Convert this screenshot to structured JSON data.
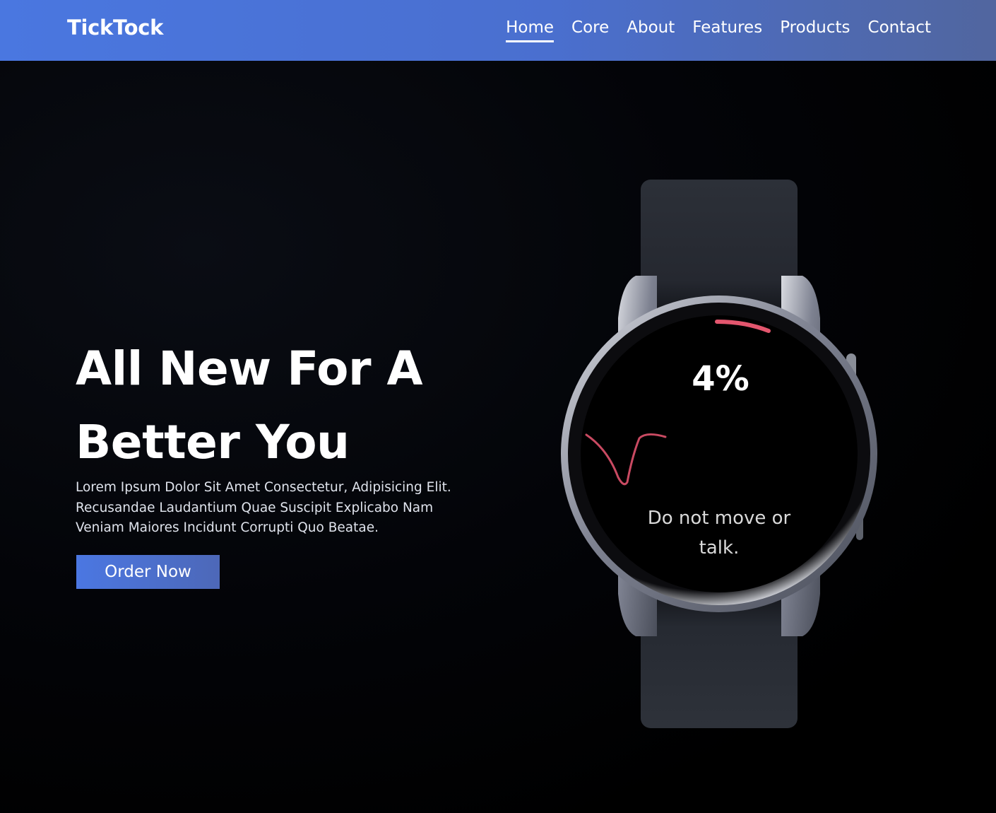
{
  "brand": {
    "name": "TickTock"
  },
  "nav": {
    "items": [
      {
        "label": "Home",
        "active": true
      },
      {
        "label": "Core",
        "active": false
      },
      {
        "label": "About",
        "active": false
      },
      {
        "label": "Features",
        "active": false
      },
      {
        "label": "Products",
        "active": false
      },
      {
        "label": "Contact",
        "active": false
      }
    ]
  },
  "hero": {
    "headline_line1": "All New For A",
    "headline_line2": "Better You",
    "lede_line1": "Lorem Ipsum Dolor Sit Amet Consectetur, Adipisicing Elit.",
    "lede_line2": "Recusandae Laudantium Quae Suscipit Explicabo Nam",
    "lede_line3": "Veniam Maiores Incidunt Corrupti Quo Beatae.",
    "cta_label": "Order Now"
  },
  "watch": {
    "readout": "4%",
    "message": "Do not move or talk."
  },
  "colors": {
    "nav_gradient_start": "#4a77e0",
    "nav_gradient_end": "#51669f",
    "cta_gradient_start": "#4b77e2",
    "cta_gradient_end": "#4d68b8",
    "hero_background": "#000000",
    "watch_accent_arc": "#e3566e",
    "watch_wave": "#c94a62"
  }
}
